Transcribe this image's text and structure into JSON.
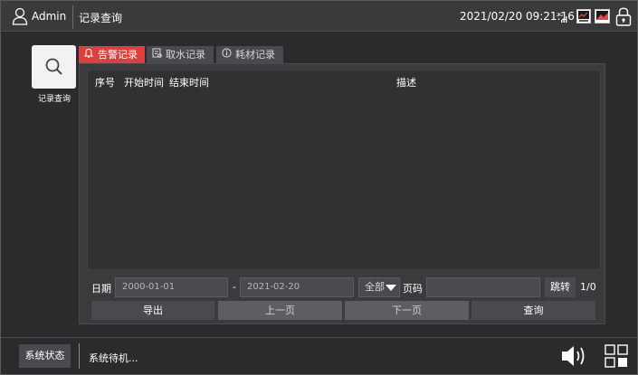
{
  "header": {
    "user_name": "Admin",
    "page_title": "记录查询",
    "datetime": "2021/02/20 09:21:16",
    "signal_label": "2G"
  },
  "nav": {
    "search_label": "记录查询"
  },
  "tabs": [
    {
      "label": "告警记录",
      "icon": "bell-icon",
      "active": true
    },
    {
      "label": "取水记录",
      "icon": "water-record-icon",
      "active": false
    },
    {
      "label": "耗材记录",
      "icon": "info-icon",
      "active": false
    }
  ],
  "table": {
    "columns": [
      "序号",
      "开始时间",
      "结束时间",
      "描述"
    ],
    "rows": []
  },
  "filter": {
    "date_label": "日期",
    "start_date": "2000-01-01",
    "date_separator": "-",
    "end_date": "2021-02-20",
    "type_select": "全部",
    "page_label": "页码",
    "page_input": "",
    "jump_label": "跳转",
    "page_count": "1/0"
  },
  "actions": {
    "export": "导出",
    "prev": "上一页",
    "next": "下一页",
    "query": "查询"
  },
  "footer": {
    "status_button": "系统状态",
    "status_text": "系统待机..."
  },
  "colors": {
    "accent_red": "#d9403e",
    "button_dark": "#4a4a4e",
    "button_disabled": "#5e5e62",
    "background": "#2b2b2d"
  }
}
